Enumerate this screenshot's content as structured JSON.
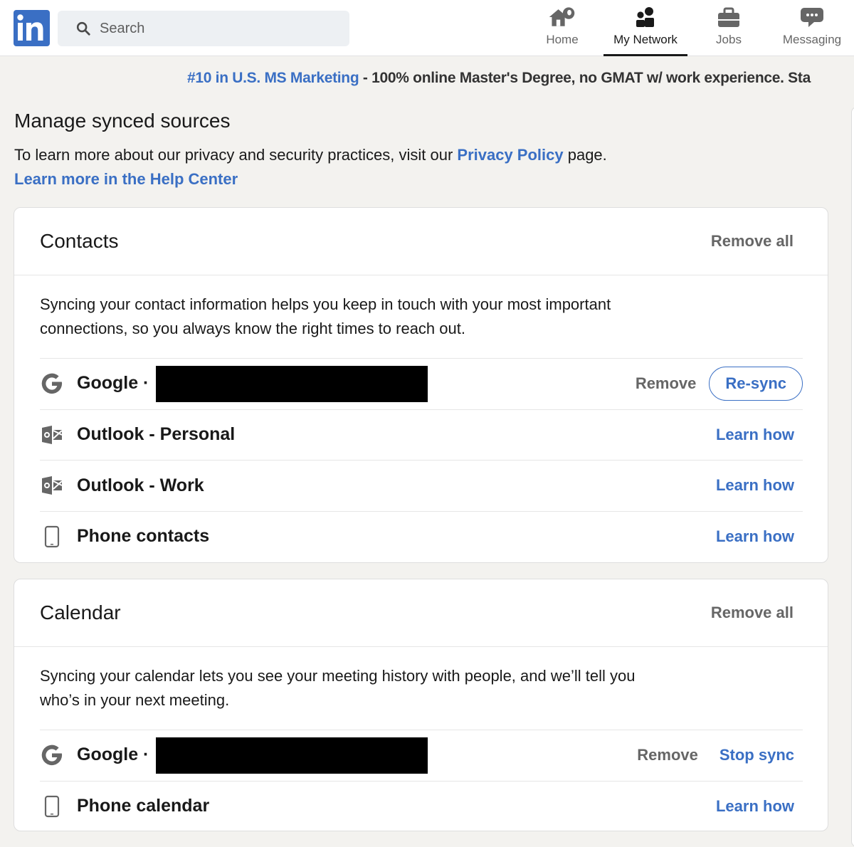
{
  "nav": {
    "logo_text": "in",
    "search_placeholder": "Search",
    "items": [
      {
        "label": "Home",
        "icon": "home-icon",
        "active": false
      },
      {
        "label": "My Network",
        "icon": "network-icon",
        "active": true
      },
      {
        "label": "Jobs",
        "icon": "briefcase-icon",
        "active": false
      },
      {
        "label": "Messaging",
        "icon": "message-icon",
        "active": false
      }
    ]
  },
  "promo": {
    "link": "#10 in U.S. MS Marketing",
    "text": " - 100% online Master's Degree, no GMAT w/ work experience. Sta"
  },
  "header": {
    "title": "Manage synced sources",
    "intro_before": "To learn more about our privacy and security practices, visit our ",
    "privacy_link": "Privacy Policy",
    "intro_after": " page.",
    "help_link": "Learn more in the Help Center"
  },
  "contacts": {
    "title": "Contacts",
    "remove_all": "Remove all",
    "description": "Syncing your contact information helps you keep in touch with your most important connections, so you always know the right times to reach out.",
    "rows": [
      {
        "icon": "google-icon",
        "name": "Google ·",
        "redacted": true,
        "remove": "Remove",
        "primary": "Re-sync"
      },
      {
        "icon": "outlook-icon",
        "name": "Outlook - Personal",
        "action": "Learn how"
      },
      {
        "icon": "outlook-icon",
        "name": "Outlook - Work",
        "action": "Learn how"
      },
      {
        "icon": "phone-icon",
        "name": "Phone contacts",
        "action": "Learn how"
      }
    ]
  },
  "calendar": {
    "title": "Calendar",
    "remove_all": "Remove all",
    "description": "Syncing your calendar lets you see your meeting history with people, and we’ll tell you who’s in your next meeting.",
    "rows": [
      {
        "icon": "google-icon",
        "name": "Google ·",
        "redacted": true,
        "remove": "Remove",
        "action": "Stop sync"
      },
      {
        "icon": "phone-icon",
        "name": "Phone calendar",
        "action": "Learn how"
      }
    ]
  },
  "colors": {
    "accent": "#3a6fc4",
    "muted": "#666666",
    "background": "#f3f2ef"
  }
}
